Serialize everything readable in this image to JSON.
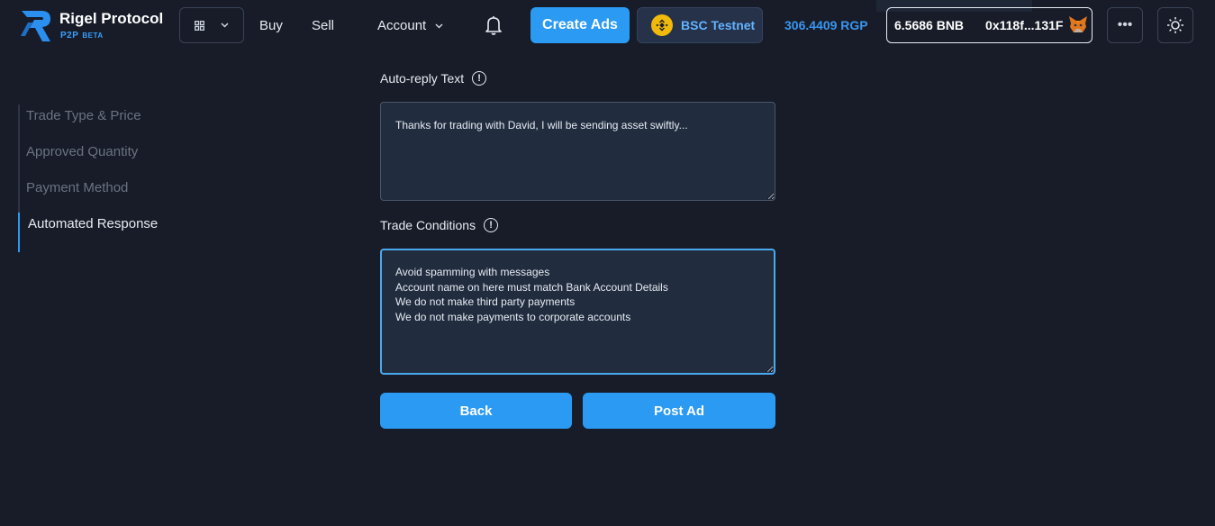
{
  "header": {
    "brand": {
      "title": "Rigel Protocol",
      "subtitle": "P2P",
      "badge": "BETA"
    },
    "nav": {
      "buy": "Buy",
      "sell": "Sell",
      "account": "Account"
    },
    "create_ads": "Create Ads",
    "network": "BSC Testnet",
    "rgp_balance": "306.4409 RGP",
    "wallet": {
      "bnb_balance": "6.5686 BNB",
      "address": "0x118f...131F"
    },
    "more": "•••",
    "icons": {
      "apps": "apps-grid-icon",
      "chevron": "chevron-down-icon",
      "bell": "bell-icon",
      "network": "binance-icon",
      "wallet": "metamask-fox-icon",
      "theme": "sun-icon"
    }
  },
  "steps": [
    {
      "label": "Trade Type & Price",
      "active": false
    },
    {
      "label": "Approved Quantity",
      "active": false
    },
    {
      "label": "Payment Method",
      "active": false
    },
    {
      "label": "Automated Response",
      "active": true
    }
  ],
  "form": {
    "auto_reply": {
      "label": "Auto-reply Text",
      "value": "Thanks for trading with David, I will be sending asset swiftly..."
    },
    "trade_conditions": {
      "label": "Trade Conditions",
      "value": "Avoid spamming with messages\nAccount name on here must match Bank Account Details\nWe do not make third party payments\nWe do not make payments to corporate accounts"
    },
    "info_icon": "!"
  },
  "buttons": {
    "back": "Back",
    "post_ad": "Post Ad"
  },
  "colors": {
    "background": "#171c28",
    "accent": "#2b9af3",
    "input_bg": "#212d3f",
    "muted_text": "#6b7280"
  }
}
